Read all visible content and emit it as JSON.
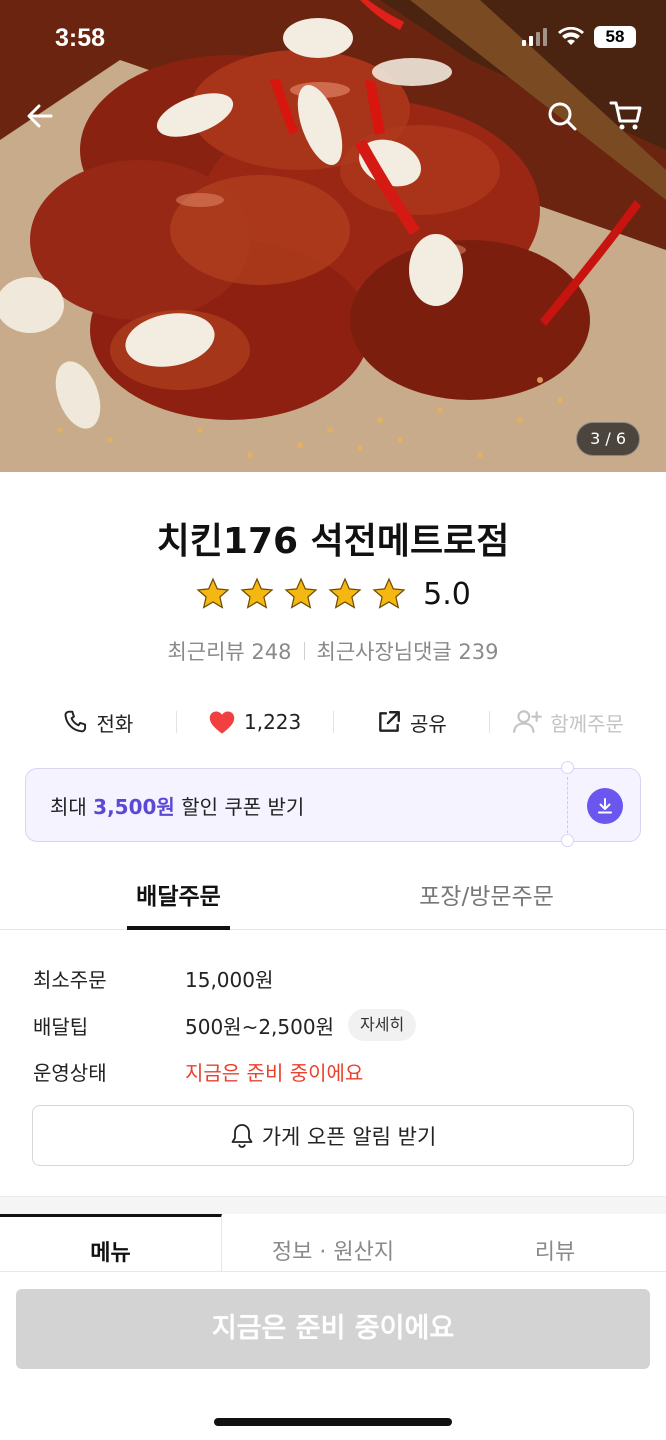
{
  "status_bar": {
    "time": "3:58",
    "battery": "58"
  },
  "hero": {
    "image_counter": "3 / 6"
  },
  "store": {
    "name": "치킨176 석전메트로점",
    "rating": "5.0",
    "stars": 5,
    "recent_reviews": "최근리뷰 248",
    "owner_replies": "최근사장님댓글 239"
  },
  "actions": {
    "call": "전화",
    "likes": "1,223",
    "share": "공유",
    "group_order": "함께주문"
  },
  "coupon": {
    "prefix": "최대 ",
    "amount": "3,500원",
    "suffix": " 할인 쿠폰 받기"
  },
  "order_tabs": {
    "delivery": "배달주문",
    "pickup": "포장/방문주문"
  },
  "info": {
    "min_order_label": "최소주문",
    "min_order_value": "15,000원",
    "delivery_tip_label": "배달팁",
    "delivery_tip_value": "500원~2,500원",
    "detail_chip": "자세히",
    "status_label": "운영상태",
    "status_value": "지금은 준비 중이에요",
    "notify_button": "가게 오픈 알림 받기"
  },
  "content_tabs": {
    "menu": "메뉴",
    "info": "정보 · 원산지",
    "reviews": "리뷰"
  },
  "cta": {
    "label": "지금은 준비 중이에요"
  },
  "colors": {
    "accent": "#5b49d6",
    "heart": "#f23f3f",
    "status_red": "#e8432f",
    "disabled_cta": "#d3d3d3"
  }
}
